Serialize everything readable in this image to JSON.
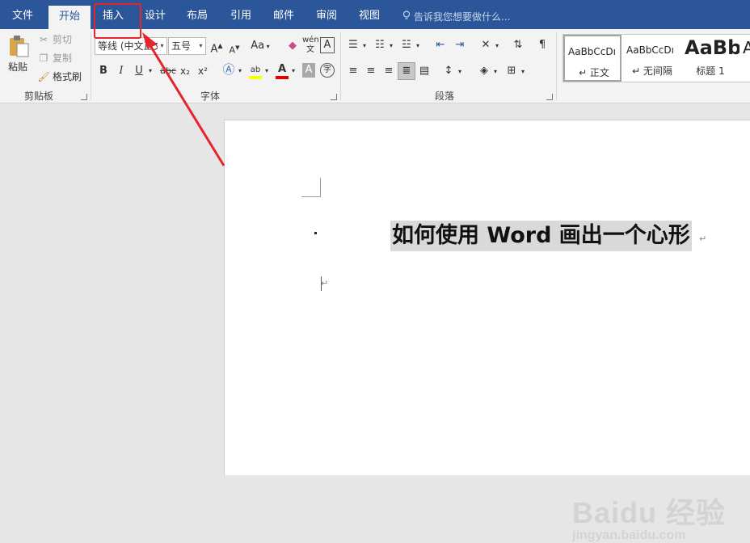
{
  "tabs": [
    {
      "label": "文件",
      "active": false
    },
    {
      "label": "开始",
      "active": true
    },
    {
      "label": "插入",
      "active": false
    },
    {
      "label": "设计",
      "active": false
    },
    {
      "label": "布局",
      "active": false
    },
    {
      "label": "引用",
      "active": false
    },
    {
      "label": "邮件",
      "active": false
    },
    {
      "label": "审阅",
      "active": false
    },
    {
      "label": "视图",
      "active": false
    }
  ],
  "tell_me": {
    "placeholder": "告诉我您想要做什么..."
  },
  "clipboard": {
    "paste": "粘贴",
    "cut": "剪切",
    "copy": "复制",
    "format_painter": "格式刷",
    "label": "剪贴板"
  },
  "font": {
    "name": "等线 (中文正文)",
    "size": "五号",
    "label": "字体",
    "bold": "B",
    "italic": "I",
    "underline": "U",
    "strike": "abc",
    "subscript": "x₂",
    "superscript": "x²",
    "grow": "A",
    "shrink": "A",
    "change_case": "Aa",
    "phonetic": "wén",
    "border_char": "A",
    "enclose": "字"
  },
  "paragraph": {
    "label": "段落"
  },
  "styles": [
    {
      "sample": "AaBbCcDı",
      "name": "↵ 正文"
    },
    {
      "sample": "AaBbCcDı",
      "name": "↵ 无间隔"
    },
    {
      "sample": "AaBb",
      "name": "标题 1"
    },
    {
      "sample": "A",
      "name": ""
    }
  ],
  "document": {
    "title": "如何使用 Word 画出一个心形",
    "pilcrow": "↵"
  },
  "watermark": {
    "line1": "Baidu 经验",
    "line2": "jingyan.baidu.com"
  },
  "colors": {
    "accent": "#2b579a",
    "annotation": "#e5242b"
  }
}
